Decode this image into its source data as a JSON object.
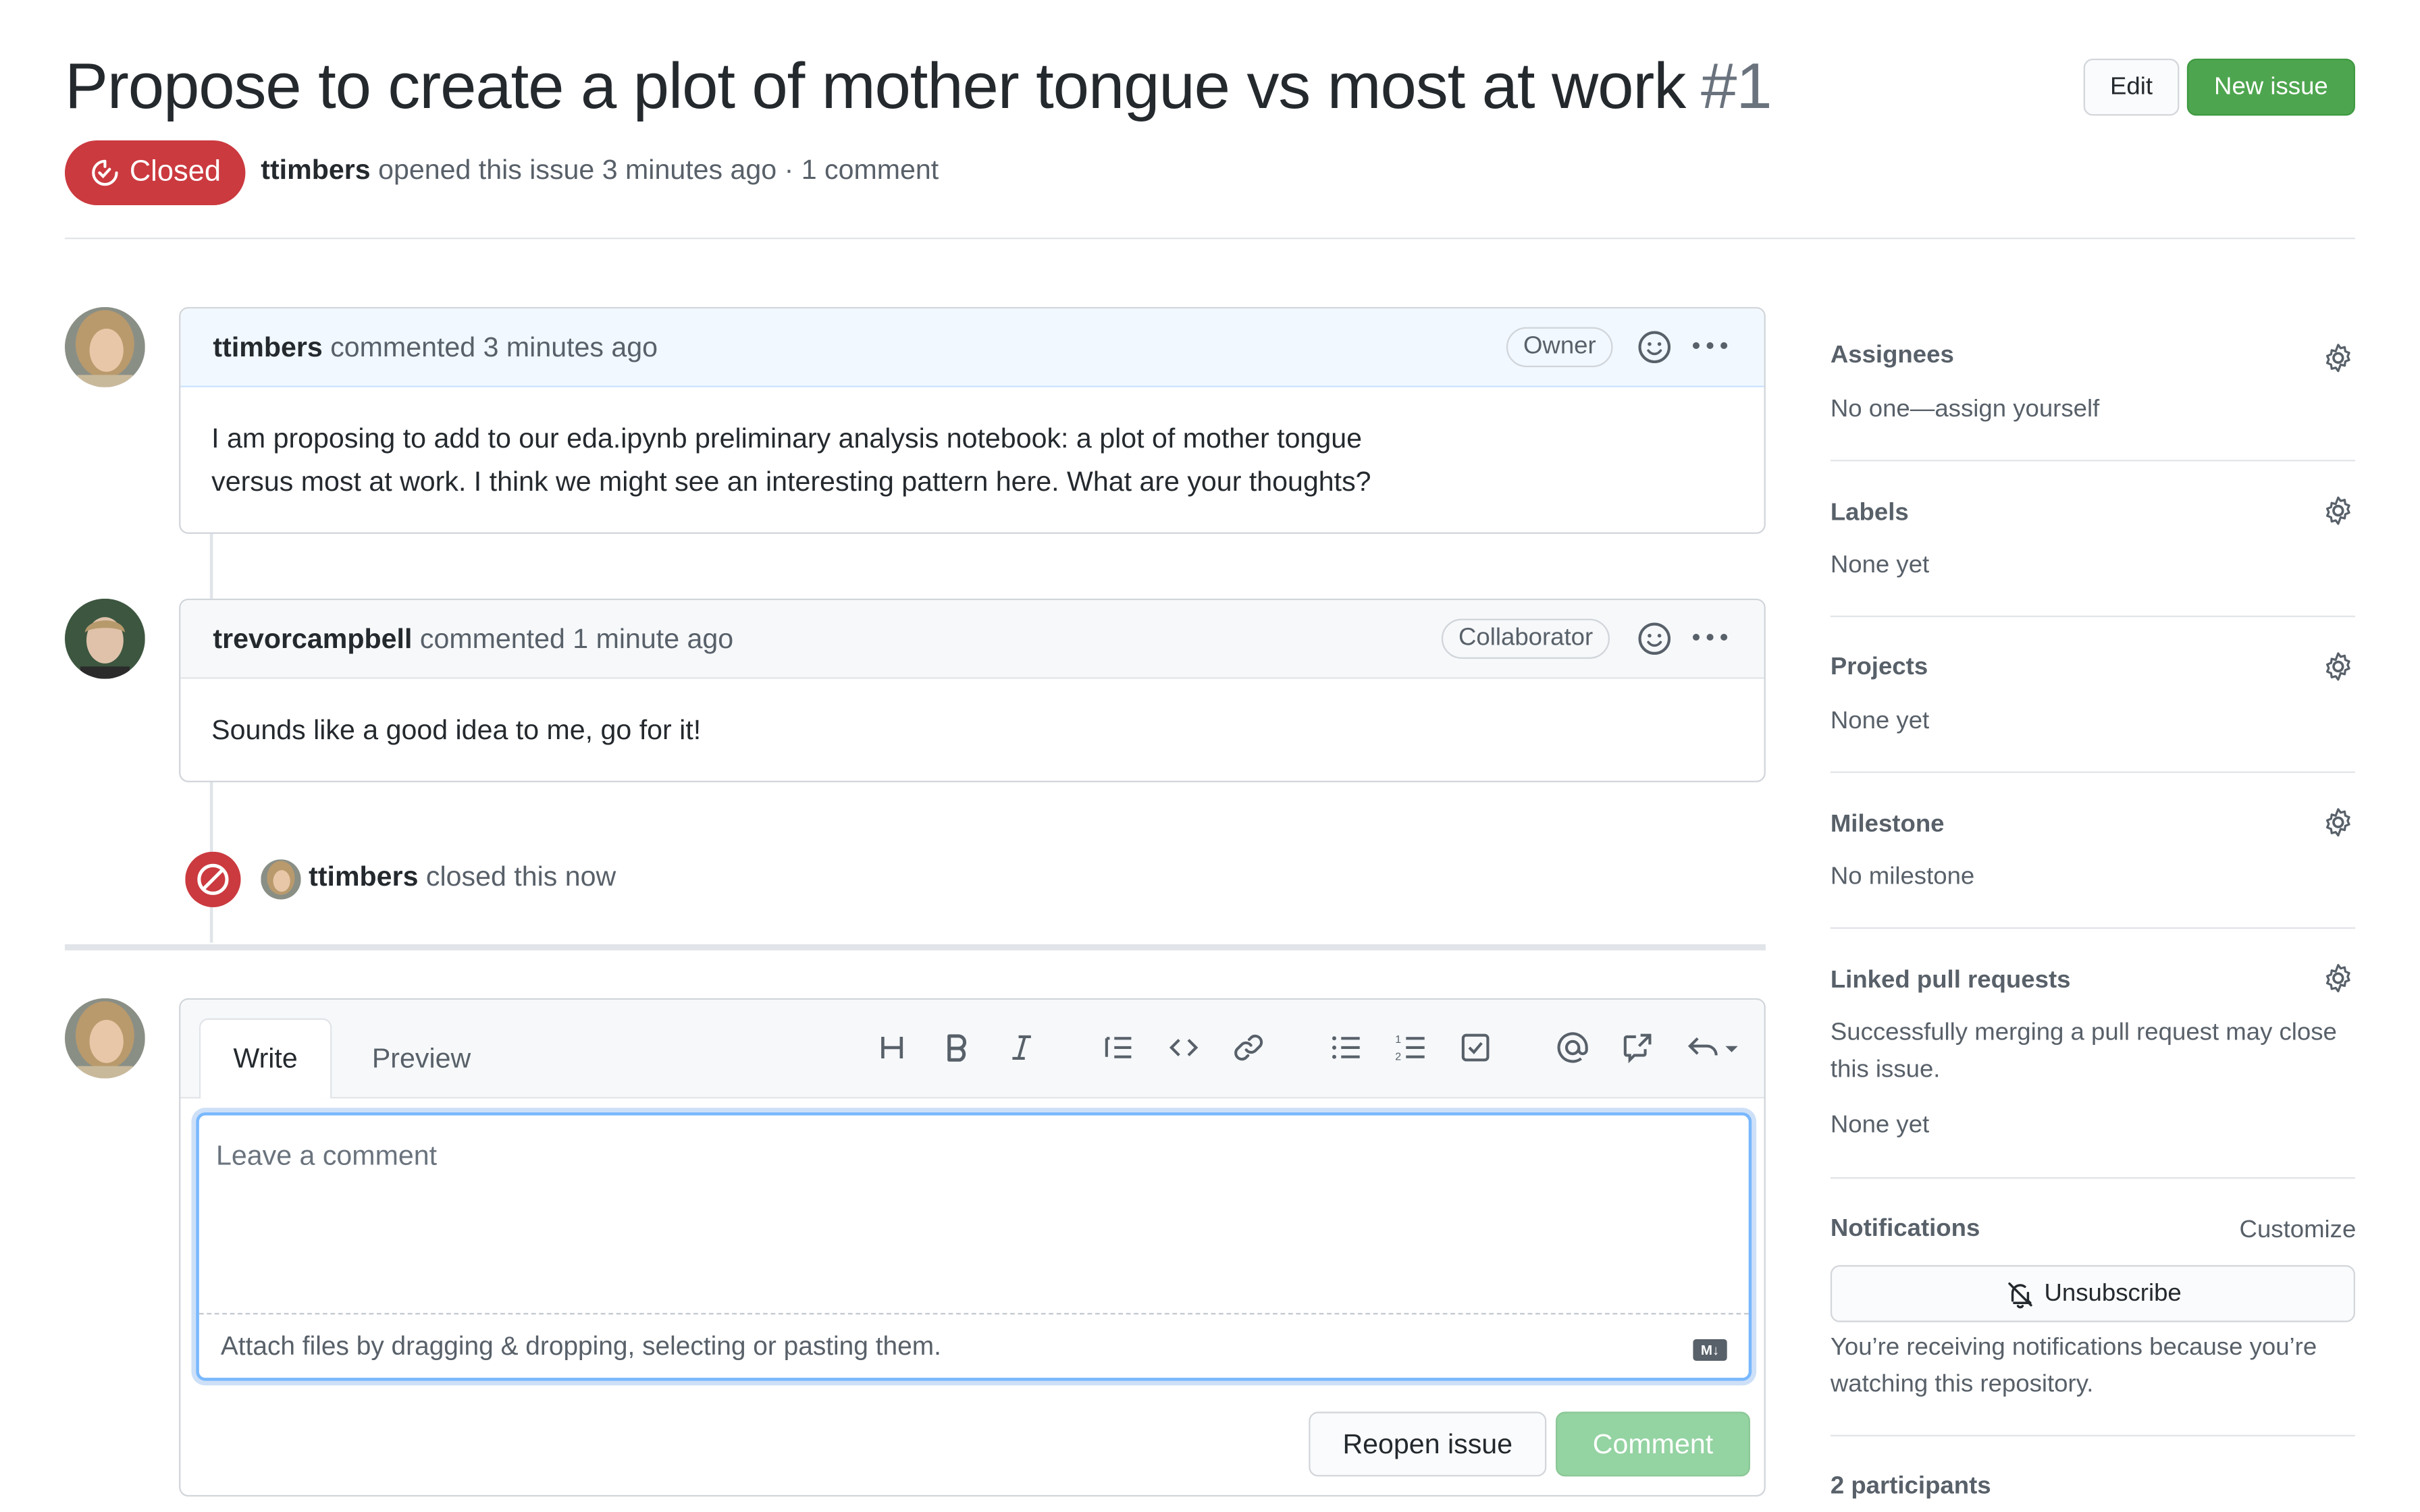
{
  "issue": {
    "title": "Propose to create a plot of mother tongue vs most at work",
    "number": "#1",
    "state": "Closed",
    "author": "ttimbers",
    "opened_text": "opened this issue 3 minutes ago · 1 comment"
  },
  "header_buttons": {
    "edit": "Edit",
    "new_issue": "New issue"
  },
  "comments": [
    {
      "author": "ttimbers",
      "action": "commented 3 minutes ago",
      "role": "Owner",
      "body": "I am proposing to add to our eda.ipynb preliminary analysis notebook: a plot of mother tongue versus most at work. I think we might see an interesting pattern here. What are your thoughts?"
    },
    {
      "author": "trevorcampbell",
      "action": "commented 1 minute ago",
      "role": "Collaborator",
      "body": "Sounds like a good idea to me, go for it!"
    }
  ],
  "event": {
    "actor": "ttimbers",
    "text": "closed this now"
  },
  "editor": {
    "tabs": [
      "Write",
      "Preview"
    ],
    "placeholder": "Leave a comment",
    "attach_text": "Attach files by dragging & dropping, selecting or pasting them.",
    "markdown_badge": "M↓",
    "reopen_button": "Reopen issue",
    "comment_button": "Comment"
  },
  "sidebar": {
    "assignees": {
      "title": "Assignees",
      "value": "No one—assign yourself"
    },
    "labels": {
      "title": "Labels",
      "value": "None yet"
    },
    "projects": {
      "title": "Projects",
      "value": "None yet"
    },
    "milestone": {
      "title": "Milestone",
      "value": "No milestone"
    },
    "linked_prs": {
      "title": "Linked pull requests",
      "note": "Successfully merging a pull request may close this issue.",
      "value": "None yet"
    },
    "notifications": {
      "title": "Notifications",
      "customize": "Customize",
      "button": "Unsubscribe",
      "note": "You’re receiving notifications because you’re watching this repository."
    },
    "participants": "2 participants"
  },
  "colors": {
    "closed_red": "#cb3a3f",
    "green": "#4ea54f",
    "link_blue": "#0366d6"
  }
}
